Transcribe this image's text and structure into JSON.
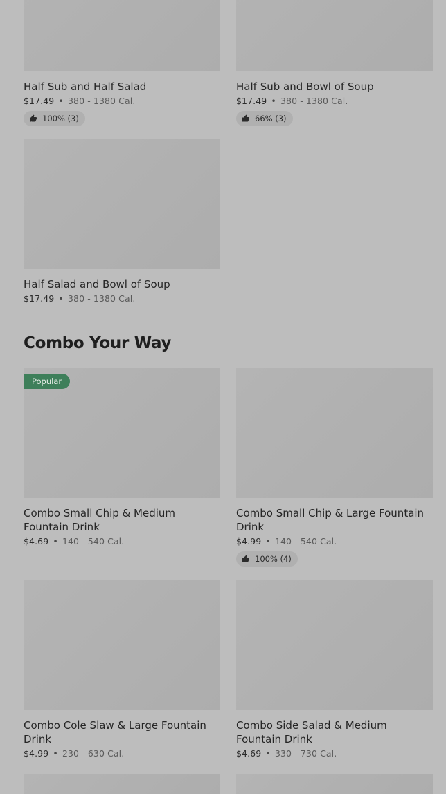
{
  "sections": {
    "combo_your_way_title": "Combo Your Way"
  },
  "items": [
    {
      "name": "Half Sub and Half Salad",
      "price": "$17.49",
      "calories": "380 - 1380 Cal.",
      "rating": "100% (3)"
    },
    {
      "name": "Half Sub and Bowl of Soup",
      "price": "$17.49",
      "calories": "380 - 1380 Cal.",
      "rating": "66% (3)"
    },
    {
      "name": "Half Salad and Bowl of Soup",
      "price": "$17.49",
      "calories": "380 - 1380 Cal."
    },
    {
      "name": "Combo Small Chip & Medium Fountain Drink",
      "price": "$4.69",
      "calories": "140 - 540 Cal.",
      "badge": "Popular"
    },
    {
      "name": "Combo Small Chip & Large Fountain Drink",
      "price": "$4.99",
      "calories": "140 - 540 Cal.",
      "rating": "100% (4)"
    },
    {
      "name": "Combo Cole Slaw & Large Fountain Drink",
      "price": "$4.99",
      "calories": "230 - 630 Cal."
    },
    {
      "name": "Combo Side Salad & Medium Fountain Drink",
      "price": "$4.69",
      "calories": "330 - 730 Cal."
    }
  ],
  "separator": "•",
  "icons": {
    "rating": "thumbs-up-icon"
  },
  "colors": {
    "popular_badge": "#3e7f5a"
  }
}
